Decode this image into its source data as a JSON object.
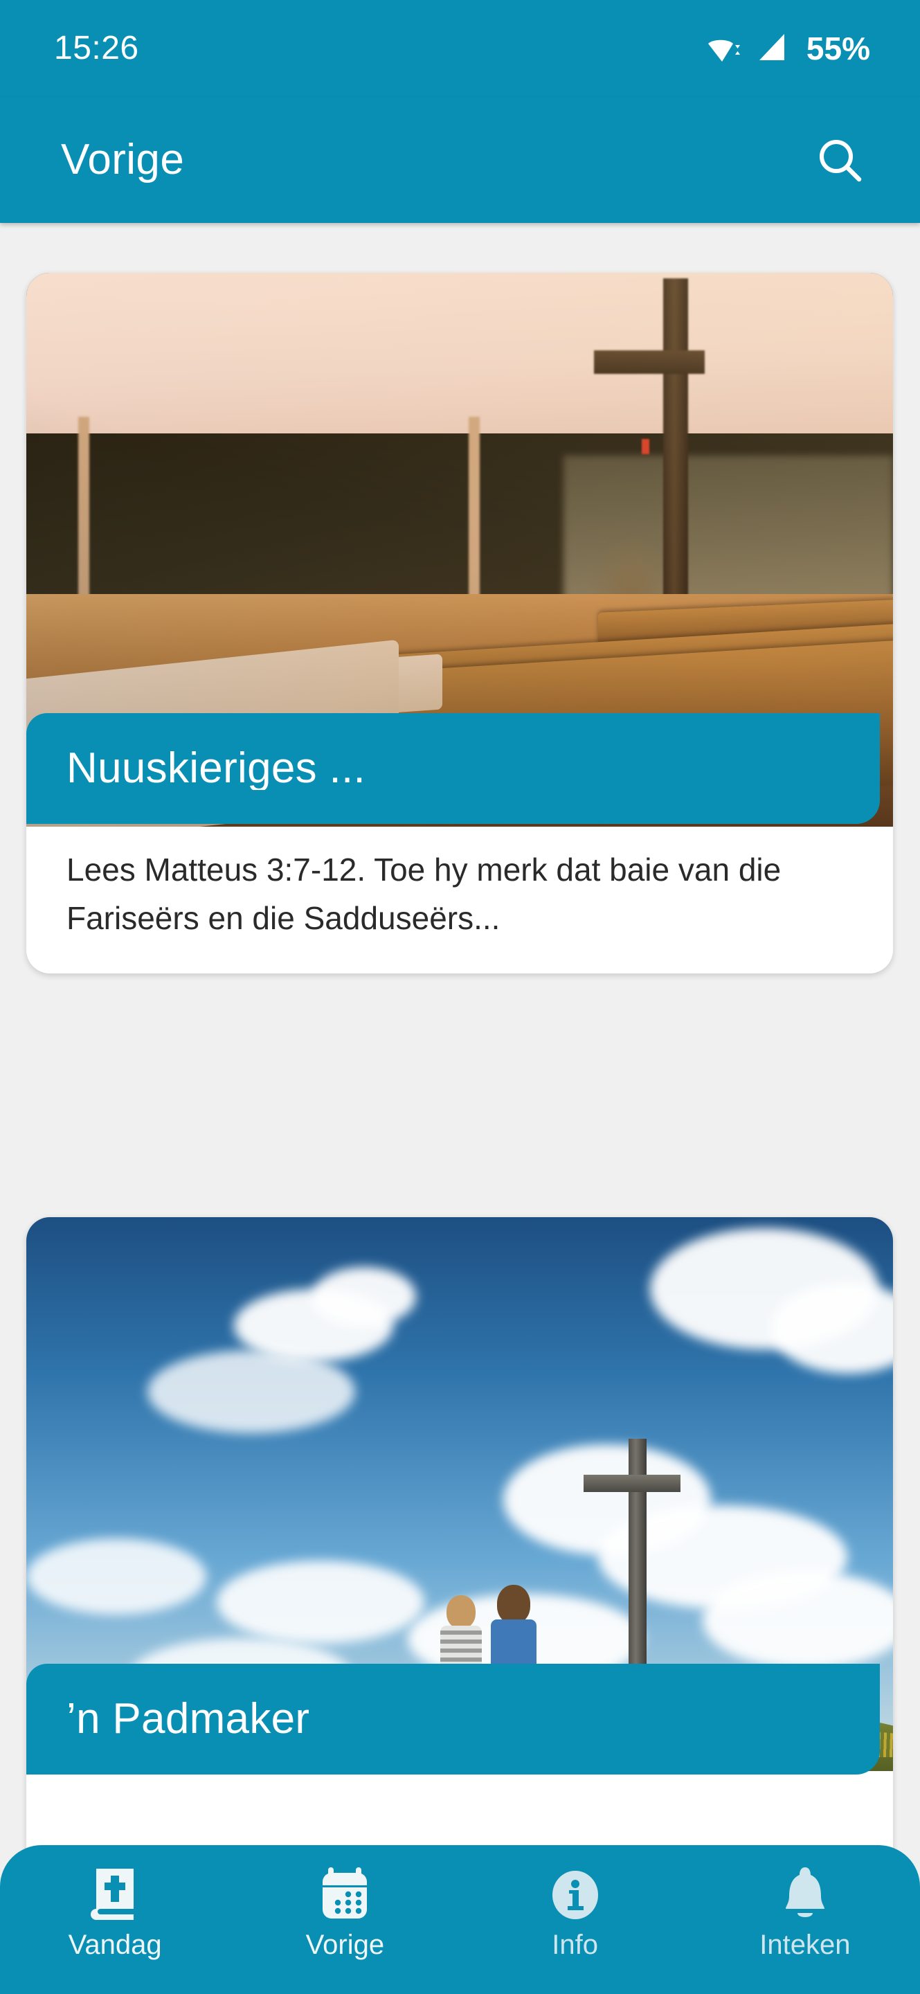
{
  "status_bar": {
    "time": "15:26",
    "battery_percent": "55%",
    "wifi_icon": "wifi-icon",
    "signal_icon": "cellular-signal-icon"
  },
  "app_bar": {
    "title": "Vorige",
    "search_icon": "search-icon"
  },
  "theme": {
    "accent": "#0a8fb4",
    "page_background": "#f0f0f0",
    "card_background": "#ffffff",
    "on_accent_text": "#ffffff",
    "body_text": "#2a2a2a"
  },
  "devotion_cards": [
    {
      "title": "Nuuskieriges ...",
      "excerpt": "Lees Matteus 3:7-12. Toe hy merk dat baie van die Fariseërs en die Sadduseërs...",
      "image_alt": "church-interior-pews-cross-photo"
    },
    {
      "title": "’n Padmaker",
      "excerpt": "",
      "image_alt": "children-looking-at-cross-on-hill-photo"
    }
  ],
  "bottom_nav": {
    "items": [
      {
        "label": "Vandag",
        "icon": "bible-book-cross-icon"
      },
      {
        "label": "Vorige",
        "icon": "calendar-icon"
      },
      {
        "label": "Info",
        "icon": "info-circle-icon"
      },
      {
        "label": "Inteken",
        "icon": "bell-icon"
      }
    ]
  }
}
